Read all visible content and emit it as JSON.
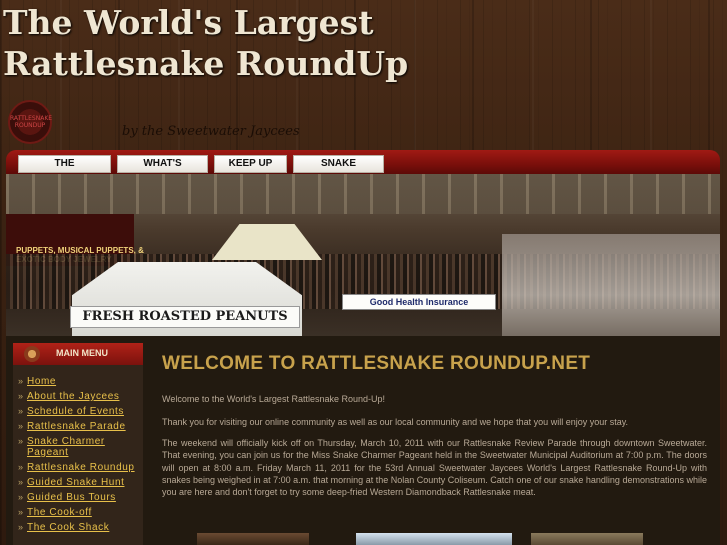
{
  "site": {
    "title": "The World's Largest Rattlesnake RoundUp",
    "tagline": "by the Sweetwater Jaycees",
    "seal_text": "RATTLESNAKE ROUNDUP"
  },
  "nav": {
    "items": [
      "THE JAYCEES",
      "WHAT'S NEW",
      "KEEP UP",
      "SNAKE HUNT"
    ]
  },
  "banner": {
    "sign_main": "FRESH ROASTED PEANUTS",
    "sign_secondary": "Good Health Insurance",
    "booth_text": "PUPPETS, MUSICAL PUPPETS, & EXOTIC BODY JEWELRY"
  },
  "sidebar": {
    "title": "MAIN MENU",
    "items": [
      "Home",
      "About the Jaycees",
      "Schedule of Events",
      "Rattlesnake Parade",
      "Snake Charmer Pageant",
      "Rattlesnake Roundup",
      "Guided Snake Hunt",
      "Guided Bus Tours",
      "The Cook-off",
      "The Cook Shack"
    ]
  },
  "main": {
    "heading": "WELCOME TO RATTLESNAKE ROUNDUP.NET",
    "paragraphs": [
      "Welcome to the World's Largest Rattlesnake Round-Up!",
      "Thank you for visiting our online community as well as our local community and we hope that you will enjoy your stay.",
      "The weekend will officially kick off on Thursday, March 10, 2011 with our Rattlesnake Review Parade through downtown Sweetwater. That evening, you can join us for the Miss Snake Charmer Pageant held in the Sweetwater Municipal Auditorium at 7:00 p.m. The doors will open at 8:00 a.m. Friday March 11, 2011 for the 53rd Annual Sweetwater Jaycees World's Largest Rattlesnake Round-Up with snakes being weighed in at 7:00 a.m. that morning at the Nolan County Coliseum. Catch one of our snake handling demonstrations while you are here and don't forget to try some deep-fried Western Diamondback Rattlesnake meat."
    ]
  },
  "colors": {
    "accent_red": "#a01a14",
    "heading_gold": "#c8a24c",
    "link_gold": "#e8c04a",
    "content_bg": "#221a10",
    "body_text": "#b8a996"
  }
}
